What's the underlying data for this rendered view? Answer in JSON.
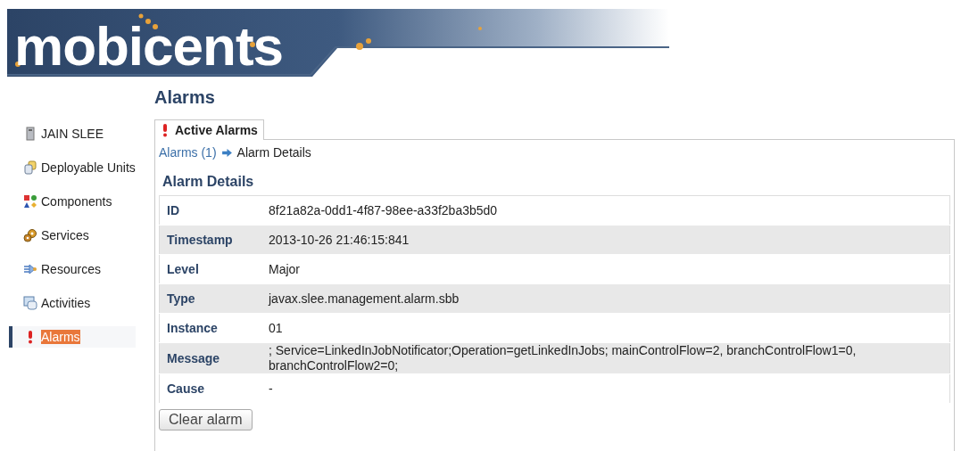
{
  "header": {
    "logo": "mobicents"
  },
  "sidebar": {
    "items": [
      {
        "label": "JAIN SLEE",
        "selected": false
      },
      {
        "label": "Deployable Units",
        "selected": false
      },
      {
        "label": "Components",
        "selected": false
      },
      {
        "label": "Services",
        "selected": false
      },
      {
        "label": "Resources",
        "selected": false
      },
      {
        "label": "Activities",
        "selected": false
      },
      {
        "label": "Alarms",
        "selected": true
      }
    ]
  },
  "page_title": "Alarms",
  "tabs": [
    {
      "label": "Active Alarms",
      "selected": true
    }
  ],
  "breadcrumb": {
    "link": "Alarms (1)",
    "current": "Alarm Details"
  },
  "section_title": "Alarm Details",
  "details": [
    {
      "label": "ID",
      "value": "8f21a82a-0dd1-4f87-98ee-a33f2ba3b5d0"
    },
    {
      "label": "Timestamp",
      "value": "2013-10-26 21:46:15:841"
    },
    {
      "label": "Level",
      "value": "Major"
    },
    {
      "label": "Type",
      "value": "javax.slee.management.alarm.sbb"
    },
    {
      "label": "Instance",
      "value": "01"
    },
    {
      "label": "Message",
      "value": "; Service=LinkedInJobNotificator;Operation=getLinkedInJobs; mainControlFlow=2, branchControlFlow1=0, branchControlFlow2=0;"
    },
    {
      "label": "Cause",
      "value": "-"
    }
  ],
  "buttons": [
    "Clear alarm"
  ]
}
